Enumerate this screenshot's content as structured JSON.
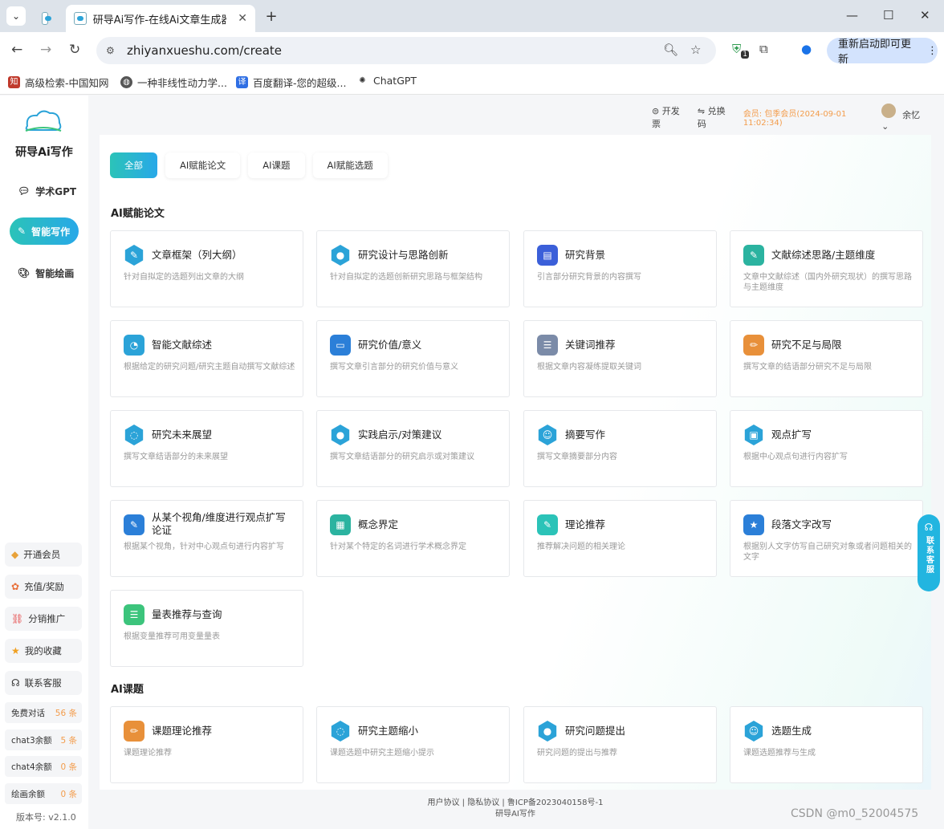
{
  "browser": {
    "tab_title": "研导Ai写作-在线Ai文章生成器-",
    "url": "zhiyanxueshu.com/create",
    "update_label": "重新启动即可更新",
    "ext_badge": "1",
    "bookmarks": [
      "高级检索-中国知网",
      "一种非线性动力学...",
      "百度翻译-您的超级...",
      "ChatGPT"
    ]
  },
  "sidebar": {
    "logo_text": "研导AI",
    "app_name": "研导Ai写作",
    "nav": [
      "学术GPT",
      "智能写作",
      "智能绘画"
    ],
    "buttons": [
      "开通会员",
      "充值/奖励",
      "分销推广",
      "我的收藏",
      "联系客服"
    ],
    "quotas": [
      {
        "label": "免费对话",
        "value": "56 条"
      },
      {
        "label": "chat3余额",
        "value": "5 条"
      },
      {
        "label": "chat4余额",
        "value": "0 条"
      },
      {
        "label": "绘画余额",
        "value": "0 条"
      }
    ],
    "version": "版本号: v2.1.0"
  },
  "topbar": {
    "invoice": "开发票",
    "redeem": "兑换码",
    "member": "会员: 包季会员(2024-09-01 11:02:34)",
    "user": "余忆"
  },
  "filters": [
    "全部",
    "AI赋能论文",
    "AI课题",
    "AI赋能选题"
  ],
  "sections": [
    "AI赋能论文",
    "AI课题"
  ],
  "cards_paper": [
    {
      "title": "文章框架（列大纲）",
      "desc": "针对自拟定的选题列出文章的大纲"
    },
    {
      "title": "研究设计与思路创新",
      "desc": "针对自拟定的选题创新研究思路与框架结构"
    },
    {
      "title": "研究背景",
      "desc": "引言部分研究背景的内容撰写"
    },
    {
      "title": "文献综述思路/主题维度",
      "desc": "文章中文献综述（国内外研究现状）的撰写思路与主题维度"
    },
    {
      "title": "智能文献综述",
      "desc": "根据给定的研究问题/研究主题自动撰写文献综述"
    },
    {
      "title": "研究价值/意义",
      "desc": "撰写文章引言部分的研究价值与意义"
    },
    {
      "title": "关键词推荐",
      "desc": "根据文章内容凝练提取关键词"
    },
    {
      "title": "研究不足与局限",
      "desc": "撰写文章的结语部分研究不足与局限"
    },
    {
      "title": "研究未来展望",
      "desc": "撰写文章结语部分的未来展望"
    },
    {
      "title": "实践启示/对策建议",
      "desc": "撰写文章结语部分的研究启示或对策建议"
    },
    {
      "title": "摘要写作",
      "desc": "撰写文章摘要部分内容"
    },
    {
      "title": "观点扩写",
      "desc": "根据中心观点句进行内容扩写"
    },
    {
      "title": "从某个视角/维度进行观点扩写论证",
      "desc": "根据某个视角，针对中心观点句进行内容扩写"
    },
    {
      "title": "概念界定",
      "desc": "针对某个特定的名词进行学术概念界定"
    },
    {
      "title": "理论推荐",
      "desc": "推荐解决问题的相关理论"
    },
    {
      "title": "段落文字改写",
      "desc": "根据别人文字仿写自己研究对象或者问题相关的文字"
    },
    {
      "title": "量表推荐与查询",
      "desc": "根据变量推荐可用变量量表"
    }
  ],
  "cards_topic": [
    {
      "title": "课题理论推荐",
      "desc": "课题理论推荐"
    },
    {
      "title": "研究主题缩小",
      "desc": "课题选题中研究主题缩小提示"
    },
    {
      "title": "研究问题提出",
      "desc": "研究问题的提出与推荐"
    },
    {
      "title": "选题生成",
      "desc": "课题选题推荐与生成"
    }
  ],
  "footer": {
    "line1": "用户协议 | 隐私协议 | 鲁ICP备2023040158号-1",
    "line2": "研导AI写作"
  },
  "float_contact": "联系客服",
  "watermark": "CSDN @m0_52004575",
  "colors": {
    "accent": "#2bc3b8",
    "accent2": "#28a8e8",
    "member": "#f39c4b"
  }
}
